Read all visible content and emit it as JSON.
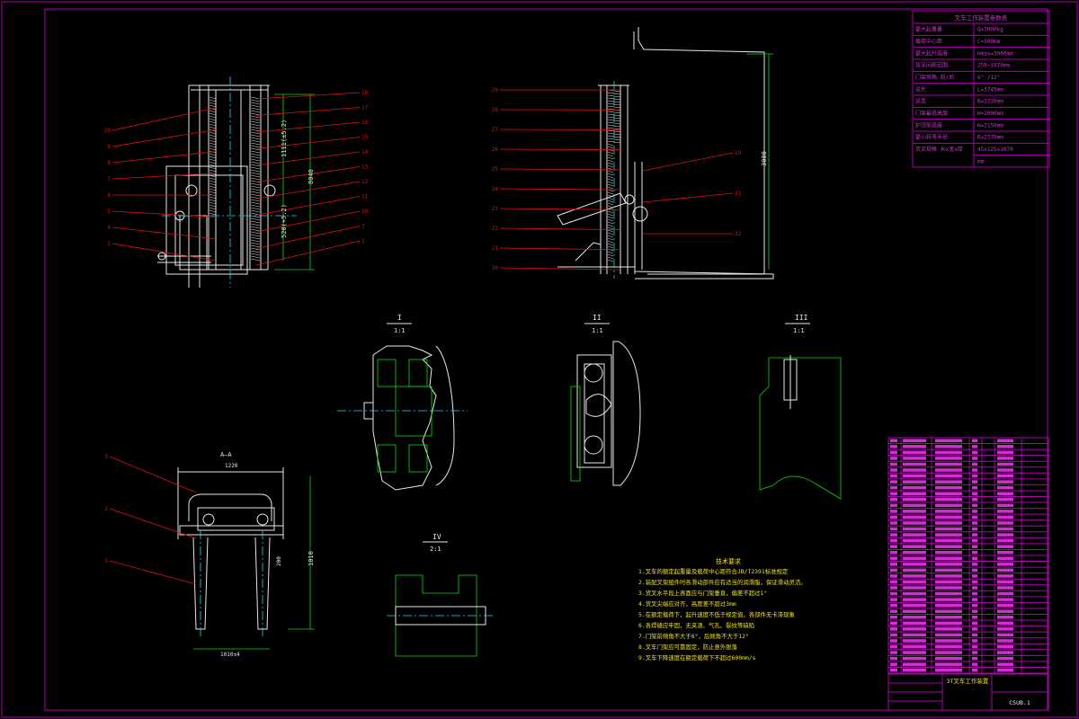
{
  "drawing": {
    "title_block_name": "3T叉车工作装置",
    "drawing_no": "CSUB.1",
    "section_labels": {
      "view_I": "I",
      "view_I_scale": "1:1",
      "view_II": "II",
      "view_II_scale": "1:1",
      "view_III": "III",
      "view_III_scale": "1:1",
      "view_IV": "IV",
      "view_IV_scale": "2:1",
      "view_AA": "A—A"
    },
    "dimensions": {
      "width_bottom_view": "1220",
      "height_left": "8040",
      "dim_left_a": "1111(±5.2)",
      "dim_left_b": "520(+5.2)",
      "dim_right_height": "3000",
      "dim_section_height": "1010",
      "dim_section_bottom": "1010±4",
      "dim_section_side": "200"
    },
    "spec_table": {
      "title": "叉车工作装置参数表",
      "rows": [
        {
          "label": "最大起重量",
          "value": "Q=3000kg"
        },
        {
          "label": "载荷中心距",
          "value": "C=500mm"
        },
        {
          "label": "最大起升高度",
          "value": "Hmax=3000mm"
        },
        {
          "label": "货叉间距范围",
          "value": "250~1070mm"
        },
        {
          "label": "门架倾角 前/后",
          "value": "6° /12°"
        },
        {
          "label": "总长",
          "value": "L=3745mm"
        },
        {
          "label": "总宽",
          "value": "B=1220mm"
        },
        {
          "label": "门架最低高度",
          "value": "H=2000mm"
        },
        {
          "label": "护顶架高度",
          "value": "H=2150mm"
        },
        {
          "label": "最小转弯半径",
          "value": "R=2370mm"
        },
        {
          "label": "货叉规格 长x宽x厚",
          "value": "45x125x1070"
        },
        {
          "label": "",
          "value": "mm"
        }
      ]
    },
    "tech_requirements": {
      "title": "技术要求",
      "items": [
        "1.叉车的额定起重量及载荷中心距符合JB/T2391标准规定",
        "2.装配叉架组件时各滑动部件应有适当的润滑脂，保证滑动灵活。",
        "3.货叉水平段上表面应与门架垂直，偏差不超过1°",
        "4.货叉尖端应对齐，高度差不超过3mm",
        "5.在额定载荷下，起升速度不低于规定值，各部件无卡滞现象",
        "6.各焊缝应牢固，无夹渣、气孔、裂纹等缺陷",
        "7.门架前倾角不大于6°，后倾角不大于12°",
        "8.叉车门架应可靠固定，防止意外脱落",
        "9.叉车下降速度在额定载荷下不超过600mm/s"
      ]
    },
    "left_callouts_left": [
      "20",
      "9",
      "8",
      "7",
      "6",
      "5",
      "4",
      "3"
    ],
    "left_callouts_right": [
      "18",
      "17",
      "16",
      "15",
      "14",
      "13",
      "12",
      "11",
      "10",
      "2",
      "1"
    ],
    "right_callouts_left": [
      "29",
      "28",
      "27",
      "26",
      "25",
      "24",
      "23",
      "22",
      "21",
      "30"
    ],
    "right_callouts_right": [
      "19",
      "31",
      "32"
    ],
    "section_callouts": [
      "3",
      "2",
      "1"
    ],
    "bom_rows": 40
  },
  "colors": {
    "frame": "#b000b0",
    "lines": "#e8e8e8",
    "leaders": "#e01010",
    "hatch": "#12d612",
    "center": "#20d8e8",
    "text_yellow": "#f0e020",
    "table_text": "#d030d0"
  }
}
